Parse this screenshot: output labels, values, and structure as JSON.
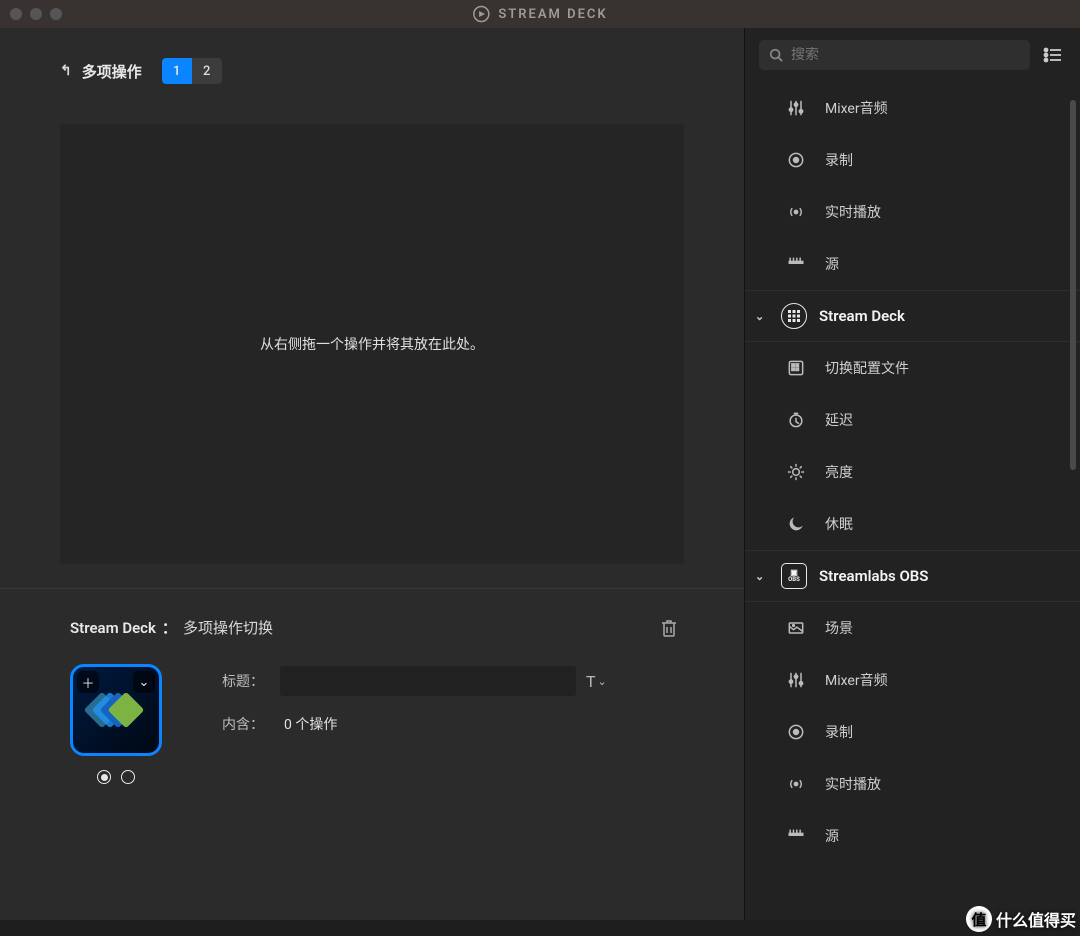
{
  "titlebar": {
    "title": "STREAM DECK"
  },
  "page": {
    "back_label": "多项操作",
    "tabs": [
      "1",
      "2"
    ],
    "active_tab": 0,
    "dropzone_hint": "从右侧拖一个操作并将其放在此处。"
  },
  "inspector": {
    "group": "Stream Deck",
    "name": "多项操作切换",
    "title_label": "标题：",
    "title_value": "",
    "count_label": "内含：",
    "count_value": "0 个操作"
  },
  "search": {
    "placeholder": "搜索"
  },
  "actions_top": [
    {
      "icon": "mixer",
      "label": "Mixer音频"
    },
    {
      "icon": "record",
      "label": "录制"
    },
    {
      "icon": "live",
      "label": "实时播放"
    },
    {
      "icon": "source",
      "label": "源"
    }
  ],
  "categories": [
    {
      "name": "Stream Deck",
      "icon": "grid",
      "items": [
        {
          "icon": "profile",
          "label": "切换配置文件"
        },
        {
          "icon": "delay",
          "label": "延迟"
        },
        {
          "icon": "brightness",
          "label": "亮度"
        },
        {
          "icon": "sleep",
          "label": "休眠"
        }
      ]
    },
    {
      "name": "Streamlabs OBS",
      "icon": "obs",
      "items": [
        {
          "icon": "scene",
          "label": "场景"
        },
        {
          "icon": "mixer",
          "label": "Mixer音频"
        },
        {
          "icon": "record",
          "label": "录制"
        },
        {
          "icon": "live",
          "label": "实时播放"
        },
        {
          "icon": "source",
          "label": "源"
        }
      ]
    }
  ],
  "watermark": "什么值得买"
}
